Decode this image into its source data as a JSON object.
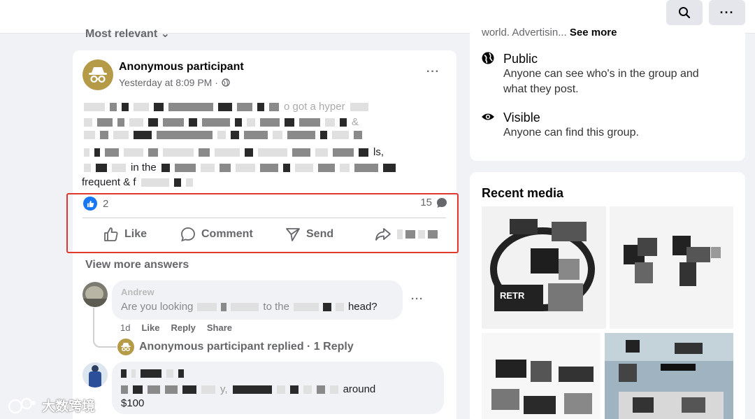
{
  "topbar": {
    "search_icon": "search-icon",
    "more_icon": "more-horizontal-icon"
  },
  "feed": {
    "sort_label": "Most relevant ⌄"
  },
  "post": {
    "author": "Anonymous participant",
    "timestamp": "Yesterday at 8:09 PM ·",
    "privacy_icon": "globe-icon",
    "body_fragments": [
      "o got a hyper",
      "&",
      "ls,",
      "in the",
      "frequent & f"
    ],
    "reaction_count": "2",
    "comment_count": "15",
    "actions": {
      "like": "Like",
      "comment": "Comment",
      "send": "Send",
      "share": "Share"
    }
  },
  "comments": {
    "view_more": "View more answers",
    "items": [
      {
        "name": "Andrew",
        "text_start": "Are you looking",
        "text_mid": "to the",
        "text_end": "head?",
        "time": "1d",
        "like": "Like",
        "reply": "Reply",
        "share": "Share",
        "replied_text": "Anonymous participant replied · 1 Reply"
      },
      {
        "name": "",
        "text_mid": "y,",
        "text_end": "around",
        "text_line2": "$100"
      }
    ]
  },
  "group_info": {
    "cut_text": "world. Advertisin...",
    "see_more": "See more",
    "public_title": "Public",
    "public_desc": "Anyone can see who's in the group and what they post.",
    "visible_title": "Visible",
    "visible_desc": "Anyone can find this group."
  },
  "recent_media": {
    "title": "Recent media",
    "tile_caption": "RETR"
  },
  "watermark": {
    "text": "大数跨境"
  },
  "colors": {
    "accent": "#1877f2",
    "highlight": "#e0392d",
    "anon": "#b59a48"
  }
}
